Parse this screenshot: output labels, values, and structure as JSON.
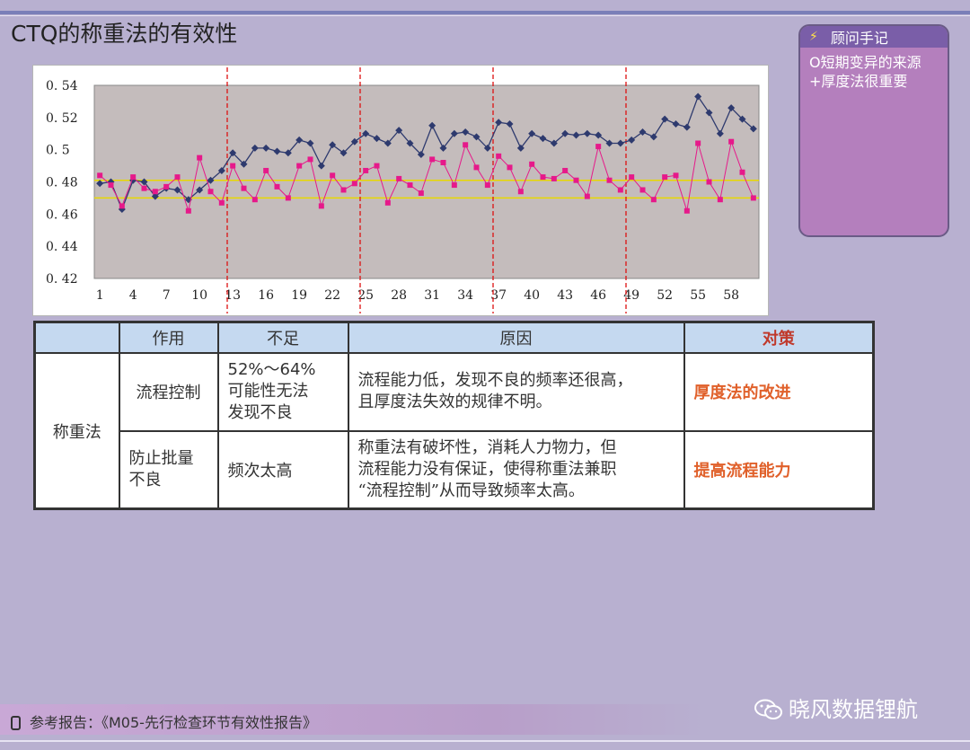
{
  "slide": {
    "title": "CTQ的称重法的有效性"
  },
  "notes": {
    "header": "顾问手记",
    "lines": [
      "O短期变异的来源",
      "+厚度法很重要"
    ]
  },
  "chart_data": {
    "type": "line",
    "x": [
      1,
      2,
      3,
      4,
      5,
      6,
      7,
      8,
      9,
      10,
      11,
      12,
      13,
      14,
      15,
      16,
      17,
      18,
      19,
      20,
      21,
      22,
      23,
      24,
      25,
      26,
      27,
      28,
      29,
      30,
      31,
      32,
      33,
      34,
      35,
      36,
      37,
      38,
      39,
      40,
      41,
      42,
      43,
      44,
      45,
      46,
      47,
      48,
      49,
      50,
      51,
      52,
      53,
      54,
      55,
      56,
      57,
      58,
      59,
      60
    ],
    "x_tick_labels": [
      "1",
      "4",
      "7",
      "10",
      "13",
      "16",
      "19",
      "22",
      "25",
      "28",
      "31",
      "34",
      "37",
      "40",
      "43",
      "46",
      "49",
      "52",
      "55",
      "58"
    ],
    "y_tick_labels": [
      "0. 54",
      "0. 52",
      "0. 5",
      "0. 48",
      "0. 46",
      "0. 44",
      "0. 42"
    ],
    "ylim": [
      0.42,
      0.54
    ],
    "series": [
      {
        "marker": "diamond",
        "color": "#2e3a6e",
        "values": [
          0.479,
          0.48,
          0.463,
          0.481,
          0.48,
          0.471,
          0.476,
          0.475,
          0.469,
          0.475,
          0.481,
          0.487,
          0.498,
          0.491,
          0.501,
          0.501,
          0.499,
          0.498,
          0.506,
          0.504,
          0.49,
          0.503,
          0.498,
          0.505,
          0.51,
          0.507,
          0.504,
          0.512,
          0.504,
          0.497,
          0.515,
          0.501,
          0.51,
          0.511,
          0.508,
          0.501,
          0.517,
          0.516,
          0.501,
          0.51,
          0.507,
          0.504,
          0.51,
          0.509,
          0.51,
          0.509,
          0.504,
          0.504,
          0.506,
          0.511,
          0.508,
          0.519,
          0.516,
          0.514,
          0.533,
          0.523,
          0.51,
          0.526,
          0.519,
          0.513
        ]
      },
      {
        "marker": "square",
        "color": "#e6198a",
        "values": [
          0.484,
          0.478,
          0.465,
          0.483,
          0.476,
          0.474,
          0.477,
          0.483,
          0.462,
          0.495,
          0.474,
          0.467,
          0.49,
          0.476,
          0.469,
          0.487,
          0.477,
          0.47,
          0.49,
          0.494,
          0.465,
          0.484,
          0.475,
          0.479,
          0.487,
          0.49,
          0.467,
          0.482,
          0.478,
          0.473,
          0.494,
          0.492,
          0.478,
          0.503,
          0.489,
          0.478,
          0.496,
          0.489,
          0.474,
          0.491,
          0.483,
          0.482,
          0.487,
          0.481,
          0.471,
          0.502,
          0.481,
          0.475,
          0.483,
          0.475,
          0.469,
          0.483,
          0.484,
          0.462,
          0.504,
          0.48,
          0.469,
          0.505,
          0.486,
          0.47
        ]
      }
    ],
    "reference_lines": [
      0.481,
      0.47
    ],
    "reference_color": "#e8d800",
    "divider_after_x": [
      12,
      24,
      36,
      48
    ],
    "divider_color": "#dd1111",
    "plot_background": "#c4bcbc",
    "grid": false
  },
  "table": {
    "headers": [
      "",
      "作用",
      "不足",
      "原因",
      "对策"
    ],
    "row_group": "称重法",
    "rows": [
      {
        "role": "流程控制",
        "shortfall": [
          "52%～64%",
          "可能性无法",
          "发现不良"
        ],
        "cause": [
          "流程能力低，发现不良的频率还很高，",
          "且厚度法失效的规律不明。"
        ],
        "strategy": "厚度法的改进"
      },
      {
        "role": [
          "防止批量",
          "不良"
        ],
        "shortfall": [
          "频次太高"
        ],
        "cause": [
          "称重法有破坏性，消耗人力物力，但",
          "流程能力没有保证，使得称重法兼职",
          "“流程控制”从而导致频率太高。"
        ],
        "strategy": "提高流程能力"
      }
    ]
  },
  "footer": {
    "reference": "参考报告：《M05-先行检查环节有效性报告》"
  },
  "watermark": "晓风数据锂航"
}
